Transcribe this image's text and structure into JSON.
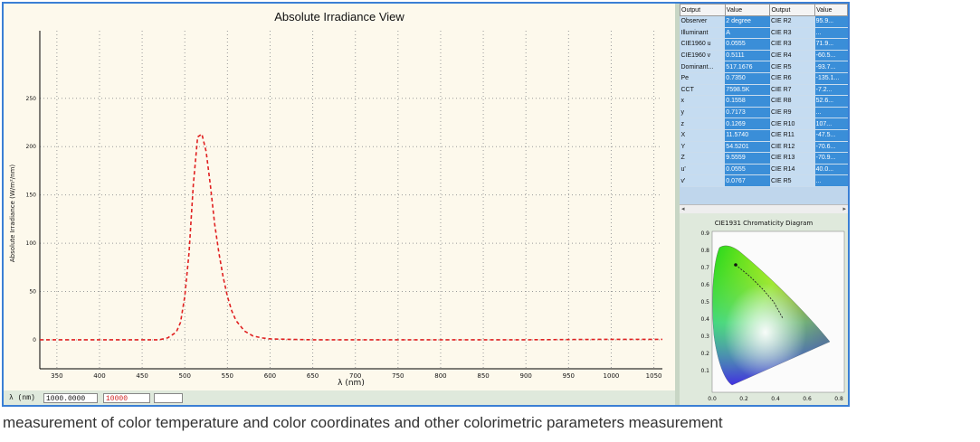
{
  "plot": {
    "title": "Absolute Irradiance View",
    "xlabel": "λ (nm)",
    "ylabel": "Absolute Irradiance (W/m²/nm)"
  },
  "chart_data": {
    "type": "line",
    "title": "Absolute Irradiance View",
    "xlabel": "λ (nm)",
    "ylabel": "Absolute Irradiance (W/m²/nm)",
    "xlim": [
      330,
      1060
    ],
    "ylim": [
      -30,
      320
    ],
    "xticks": [
      "350",
      "400",
      "450",
      "500",
      "550",
      "600",
      "650",
      "700",
      "750",
      "800",
      "850",
      "900",
      "950",
      "1000",
      "1050"
    ],
    "yticks": [
      "0",
      "50",
      "100",
      "150",
      "200",
      "250"
    ],
    "grid": true,
    "series": [
      {
        "color": "#e02020",
        "x": [
          330,
          400,
          460,
          470,
          480,
          490,
          495,
          500,
          505,
          510,
          515,
          520,
          525,
          530,
          535,
          540,
          545,
          550,
          555,
          560,
          570,
          580,
          590,
          600,
          620,
          650,
          700,
          800,
          900,
          1000,
          1060
        ],
        "y": [
          0,
          0,
          0,
          0,
          2,
          8,
          18,
          45,
          90,
          160,
          210,
          213,
          195,
          160,
          120,
          90,
          65,
          45,
          30,
          20,
          9,
          4,
          2,
          1,
          0.5,
          0,
          0,
          0,
          0,
          0.5,
          0.5
        ]
      }
    ]
  },
  "table": {
    "headers": [
      "Output",
      "Value",
      "Output",
      "Value"
    ],
    "rows": [
      [
        "Observer",
        "2 degree",
        "CIE R2",
        "95.9..."
      ],
      [
        "Illuminant",
        "A",
        "CIE R3",
        "..."
      ],
      [
        "CIE1960 u",
        "0.0555",
        "CIE R3",
        "71.9..."
      ],
      [
        "CIE1960 v",
        "0.5111",
        "CIE R4",
        "-60.5..."
      ],
      [
        "Dominant...",
        "517.1676",
        "CIE R5",
        "-93.7..."
      ],
      [
        "Pe",
        "0.7350",
        "CIE R6",
        "-135.1..."
      ],
      [
        "CCT",
        "7598.5K",
        "CIE R7",
        "-7.2..."
      ],
      [
        "x",
        "0.1558",
        "CIE R8",
        "52.6..."
      ],
      [
        "y",
        "0.7173",
        "CIE R9",
        "..."
      ],
      [
        "z",
        "0.1269",
        "CIE R10",
        "107..."
      ],
      [
        "X",
        "11.5740",
        "CIE R11",
        "-47.5..."
      ],
      [
        "Y",
        "54.5201",
        "CIE R12",
        "-70.6..."
      ],
      [
        "Z",
        "9.5559",
        "CIE R13",
        "-70.9..."
      ],
      [
        "u'",
        "0.0555",
        "CIE R14",
        "40.0..."
      ],
      [
        "v'",
        "0.0767",
        "CIE R5",
        "..."
      ]
    ]
  },
  "cie": {
    "title": "CIE1931 Chromaticity Diagram",
    "yticks": [
      "0.9",
      "0.8",
      "0.7",
      "0.6",
      "0.5",
      "0.4",
      "0.3",
      "0.2",
      "0.1"
    ],
    "xticks": [
      "0.0",
      "0.2",
      "0.4",
      "0.6",
      "0.8"
    ]
  },
  "status": {
    "lambda_label": "λ (nm)",
    "lambda_value": "1000.0000",
    "value_field": "10000"
  },
  "caption": "measurement of color temperature and color coordinates and other colorimetric parameters measurement",
  "colors": {
    "accent": "#3a7fd5",
    "series": "#e02020"
  }
}
